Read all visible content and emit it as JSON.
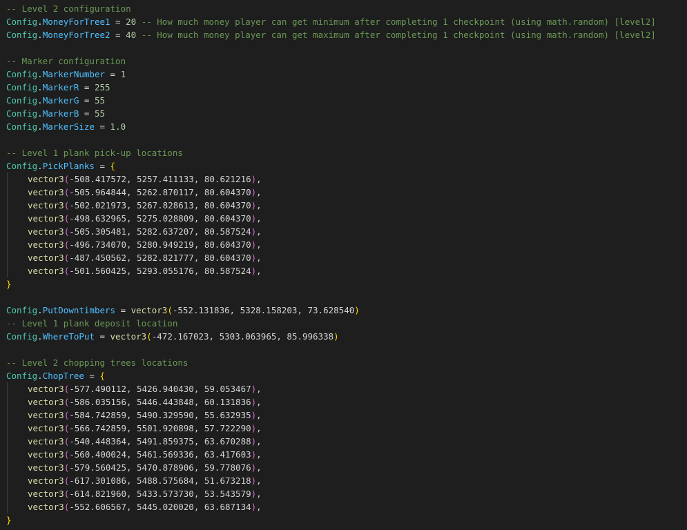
{
  "colors": {
    "background": "#1e1e1e",
    "comment": "#6a9955",
    "config_object": "#4ec9b0",
    "property": "#4fc1ff",
    "number": "#b5cea8",
    "function": "#dcdcaa",
    "brace": "#ffd700",
    "paren": "#da70d6"
  },
  "code": {
    "c_level2_config": "-- Level 2 configuration",
    "money1": {
      "obj": "Config",
      "prop": "MoneyForTree1",
      "value": "20",
      "comment": "-- How much money player can get minimum after completing 1 checkpoint (using math.random) [level2]"
    },
    "money2": {
      "obj": "Config",
      "prop": "MoneyForTree2",
      "value": "40",
      "comment": "-- How much money player can get maximum after completing 1 checkpoint (using math.random) [level2]"
    },
    "c_marker": "-- Marker configuration",
    "marker_number": {
      "obj": "Config",
      "prop": "MarkerNumber",
      "value": "1"
    },
    "marker_r": {
      "obj": "Config",
      "prop": "MarkerR",
      "value": "255"
    },
    "marker_g": {
      "obj": "Config",
      "prop": "MarkerG",
      "value": "55"
    },
    "marker_b": {
      "obj": "Config",
      "prop": "MarkerB",
      "value": "55"
    },
    "marker_size": {
      "obj": "Config",
      "prop": "MarkerSize",
      "value": "1.0"
    },
    "c_level1_pick": "-- Level 1 plank pick-up locations",
    "pick_planks": {
      "obj": "Config",
      "prop": "PickPlanks",
      "fn": "vector3",
      "items": [
        "-508.417572, 5257.411133, 80.621216",
        "-505.964844, 5262.870117, 80.604370",
        "-502.021973, 5267.828613, 80.604370",
        "-498.632965, 5275.028809, 80.604370",
        "-505.305481, 5282.637207, 80.587524",
        "-496.734070, 5280.949219, 80.604370",
        "-487.450562, 5282.821777, 80.604370",
        "-501.560425, 5293.055176, 80.587524"
      ]
    },
    "put_down": {
      "obj": "Config",
      "prop": "PutDowntimbers",
      "fn": "vector3",
      "args": "-552.131836, 5328.158203, 73.628540"
    },
    "c_level1_deposit": "-- Level 1 plank deposit location",
    "where_to_put": {
      "obj": "Config",
      "prop": "WhereToPut",
      "fn": "vector3",
      "args": "-472.167023, 5303.063965, 85.996338"
    },
    "c_level2_chop": "-- Level 2 chopping trees locations",
    "chop_tree": {
      "obj": "Config",
      "prop": "ChopTree",
      "fn": "vector3",
      "items": [
        "-577.490112, 5426.940430, 59.053467",
        "-586.035156, 5446.443848, 60.131836",
        "-584.742859, 5490.329590, 55.632935",
        "-566.742859, 5501.920898, 57.722290",
        "-540.448364, 5491.859375, 63.670288",
        "-560.400024, 5461.569336, 63.417603",
        "-579.560425, 5470.878906, 59.778076",
        "-617.301086, 5488.575684, 51.673218",
        "-614.821960, 5433.573730, 53.543579",
        "-552.606567, 5445.020020, 63.687134"
      ]
    }
  }
}
